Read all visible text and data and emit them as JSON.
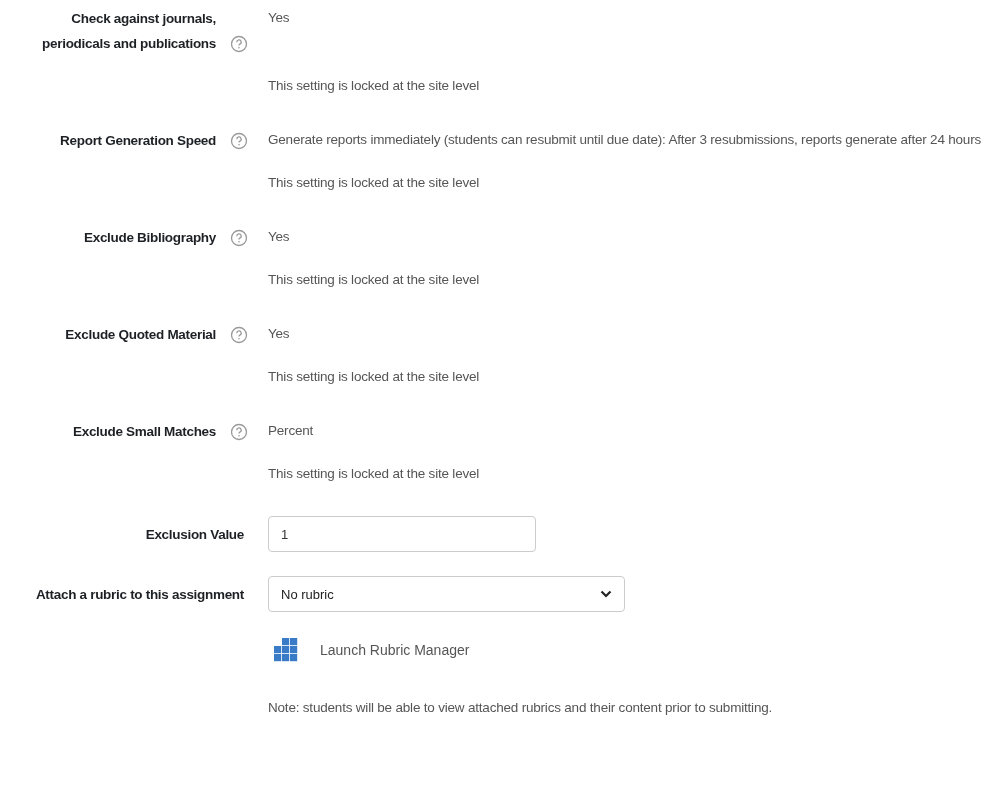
{
  "settings": [
    {
      "label": "Check against journals, periodicals and publications",
      "help": true,
      "value": "Yes",
      "note": "This setting is locked at the site level"
    },
    {
      "label": "Report Generation Speed",
      "help": true,
      "value": "Generate reports immediately (students can resubmit until due date): After 3 resubmissions, reports generate after 24 hours",
      "note": "This setting is locked at the site level"
    },
    {
      "label": "Exclude Bibliography",
      "help": true,
      "value": "Yes",
      "note": "This setting is locked at the site level"
    },
    {
      "label": "Exclude Quoted Material",
      "help": true,
      "value": "Yes",
      "note": "This setting is locked at the site level"
    },
    {
      "label": "Exclude Small Matches",
      "help": true,
      "value": "Percent",
      "note": "This setting is locked at the site level"
    }
  ],
  "exclusion_value": {
    "label": "Exclusion Value",
    "value": "1"
  },
  "rubric": {
    "label": "Attach a rubric to this assignment",
    "value": "No rubric"
  },
  "launch_link": "Launch Rubric Manager",
  "footer_note": "Note: students will be able to view attached rubrics and their content prior to submitting."
}
